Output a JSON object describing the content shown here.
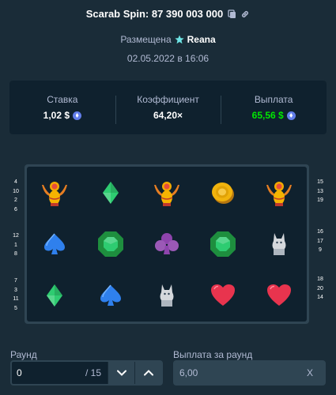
{
  "header": {
    "title": "Scarab Spin: 87 390 003 000",
    "posted_label": "Размещена",
    "user": "Reana",
    "date": "02.05.2022 в 16:06"
  },
  "stats": [
    {
      "label": "Ставка",
      "value": "1,02 $",
      "coin": "eth-coin-icon"
    },
    {
      "label": "Коэффициент",
      "value": "64,20×"
    },
    {
      "label": "Выплата",
      "value": "65,56 $",
      "coin": "eth-coin-icon"
    }
  ],
  "colors": {
    "background": "#1a2c38",
    "panel": "#0f212e",
    "border": "#2f4553",
    "payout_green": "#00e701",
    "text_muted": "#b1bad3"
  },
  "reels": [
    [
      "scarab-icon",
      "green-diamond-icon",
      "scarab-icon",
      "gold-coin-icon",
      "scarab-icon"
    ],
    [
      "blue-spade-icon",
      "green-emerald-icon",
      "purple-club-icon",
      "green-emerald-icon",
      "cat-statue-icon"
    ],
    [
      "green-diamond-icon",
      "blue-spade-icon",
      "cat-statue-icon",
      "red-heart-icon",
      "red-heart-icon"
    ]
  ],
  "paylines": {
    "left": [
      [
        "4",
        "10",
        "2",
        "6"
      ],
      [
        "12",
        "1",
        "8"
      ],
      [
        "7",
        "3",
        "11",
        "5"
      ]
    ],
    "right": [
      [
        "15",
        "13",
        "19"
      ],
      [
        "16",
        "17",
        "9"
      ],
      [
        "18",
        "20",
        "14"
      ]
    ]
  },
  "round": {
    "label": "Раунд",
    "value": "0",
    "total": "/ 15"
  },
  "round_payout": {
    "label": "Выплата за раунд",
    "value": "6,00",
    "suffix": "X"
  }
}
